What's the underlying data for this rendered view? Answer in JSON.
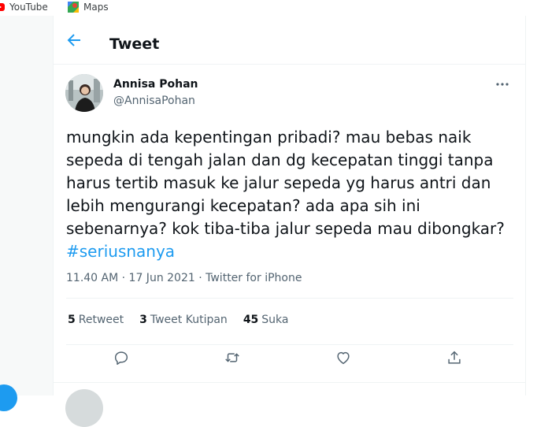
{
  "bookmarks": [
    {
      "label": "YouTube",
      "icon": "youtube-icon"
    },
    {
      "label": "Maps",
      "icon": "maps-icon"
    }
  ],
  "header": {
    "title": "Tweet",
    "back_icon": "back-arrow-icon"
  },
  "tweet": {
    "author_name": "Annisa Pohan",
    "handle": "@AnnisaPohan",
    "lines": [
      "mungkin ada kepentingan pribadi? mau bebas naik",
      "sepeda di tengah jalan dan dg kecepatan tinggi tanpa",
      "harus tertib masuk ke jalur sepeda yg harus antri dan",
      "lebih mengurangi kecepatan? ada apa sih ini",
      "sebenarnya? kok tiba-tiba jalur sepeda mau dibongkar?"
    ],
    "hashtag": "#seriusnanya",
    "time": "11.40 AM",
    "date": "17 Jun 2021",
    "source": "Twitter for iPhone",
    "meta_separator": "·"
  },
  "stats": {
    "retweets": {
      "count": "5",
      "label": "Retweet"
    },
    "quotes": {
      "count": "3",
      "label": "Tweet Kutipan"
    },
    "likes": {
      "count": "45",
      "label": "Suka"
    }
  },
  "colors": {
    "accent": "#1d9bf0",
    "text": "#0f1419",
    "muted": "#536471",
    "border": "#eff3f4"
  },
  "actions": [
    "reply-icon",
    "retweet-icon",
    "like-icon",
    "share-icon"
  ]
}
